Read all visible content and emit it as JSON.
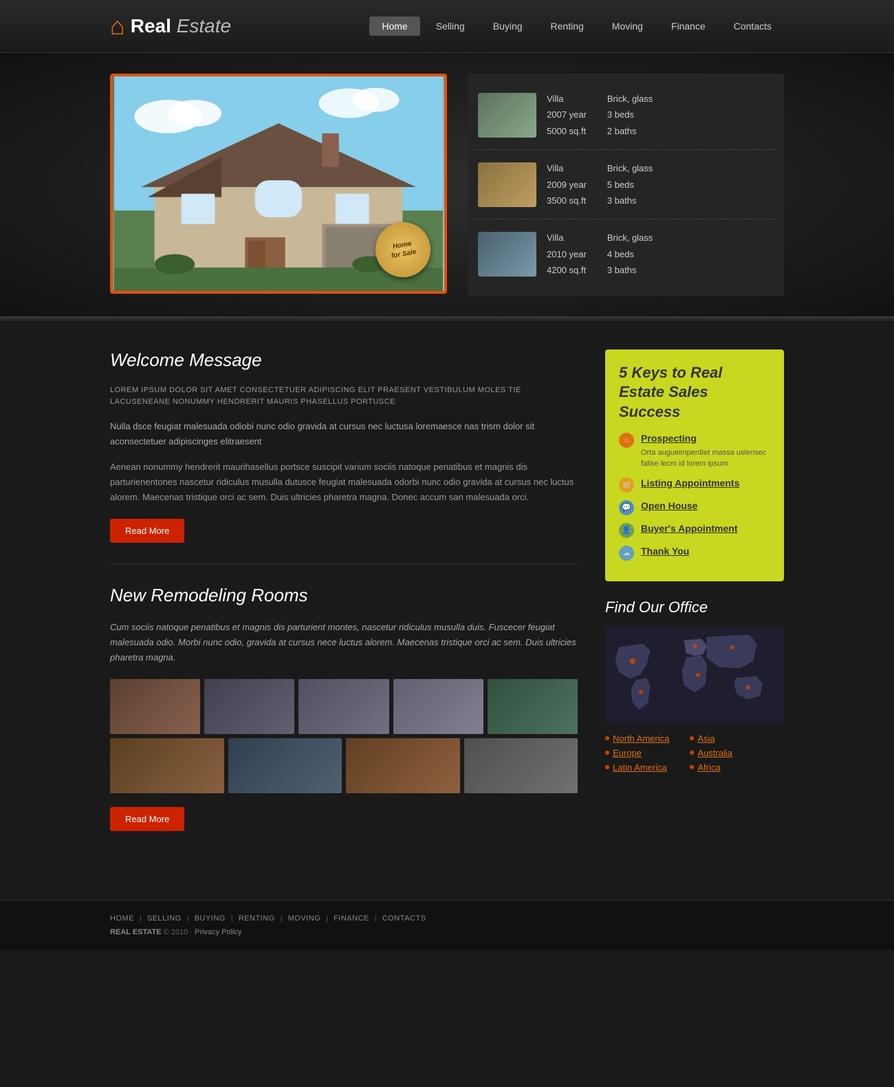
{
  "logo": {
    "real": "Real",
    "estate": "Estate"
  },
  "nav": {
    "items": [
      {
        "label": "Home",
        "active": true
      },
      {
        "label": "Selling",
        "active": false
      },
      {
        "label": "Buying",
        "active": false
      },
      {
        "label": "Renting",
        "active": false
      },
      {
        "label": "Moving",
        "active": false
      },
      {
        "label": "Finance",
        "active": false
      },
      {
        "label": "Contacts",
        "active": false
      }
    ]
  },
  "badge": {
    "line1": "Home",
    "line2": "for Sale"
  },
  "listings": [
    {
      "type": "Villa",
      "year": "2007 year",
      "sqft": "5000 sq.ft",
      "material": "Brick, glass",
      "beds": "3 beds",
      "baths": "2 baths",
      "thumbClass": "t1"
    },
    {
      "type": "Villa",
      "year": "2009 year",
      "sqft": "3500 sq.ft",
      "material": "Brick, glass",
      "beds": "5 beds",
      "baths": "3 baths",
      "thumbClass": "t2"
    },
    {
      "type": "Villa",
      "year": "2010 year",
      "sqft": "4200 sq.ft",
      "material": "Brick, glass",
      "beds": "4 beds",
      "baths": "3 baths",
      "thumbClass": "t3"
    }
  ],
  "welcome": {
    "title": "Welcome Message",
    "text_upper": "LOREM IPSUM DOLOR SIT AMET CONSECTETUER ADIPISCING ELIT PRAESENT VESTIBULUM MOLES TIE LACUSENEANE NONUMMY HENDRERIT MAURIS PHASELLUS PORTUSCE",
    "text_mid": "Nulla dsce feugiat malesuada odiobi nunc odio gravida at cursus nec luctusa loremaesce nas trism dolor sit aconsectetuer adipiscinges elitraesent",
    "text_lower": "Aenean nonummy hendrerit maurihasellus portsce suscipit varium sociis natoque penatibus et magnis dis parturienentones nascetur ridiculus musulla dutusce feugiat malesuada odorbi nunc odio gravida at cursus nec luctus alorem. Maecenas tristique orci ac sem. Duis ultricies pharetra magna. Donec accum san malesuada orci.",
    "read_more": "Read More"
  },
  "remodeling": {
    "title": "New Remodeling Rooms",
    "text": "Cum sociis natoque penatibus et magnis dis parturient montes, nascetur ridiculus musulla duis. Fuscecer feugiat malesuada odio. Morbi nunc odio, gravida at cursus nece luctus alorem. Maecenas tristique orci ac sem. Duis ultricies pharetra magna.",
    "read_more": "Read More"
  },
  "keys": {
    "title": "5 Keys to Real Estate Sales Success",
    "items": [
      {
        "label": "Prospecting",
        "desc": "Orta augueimperdiet massa uslensec falise lecm id lorem ipsum",
        "iconType": "house"
      },
      {
        "label": "Listing Appointments",
        "desc": "",
        "iconType": "folder"
      },
      {
        "label": "Open House",
        "desc": "",
        "iconType": "bubble"
      },
      {
        "label": "Buyer's Appointment",
        "desc": "",
        "iconType": "person"
      },
      {
        "label": "Thank You",
        "desc": "",
        "iconType": "cloud"
      }
    ]
  },
  "office": {
    "title": "Find Our Office",
    "col1": [
      "North America",
      "Europe",
      "Latin America"
    ],
    "col2": [
      "Asia",
      "Australia",
      "Africa"
    ]
  },
  "footer": {
    "links": [
      "HOME",
      "SELLING",
      "BUYING",
      "RENTING",
      "MOVING",
      "FINANCE",
      "CONTACTS"
    ],
    "copy": "REAL ESTATE",
    "year": "© 2010",
    "privacy": "Privacy Policy"
  }
}
